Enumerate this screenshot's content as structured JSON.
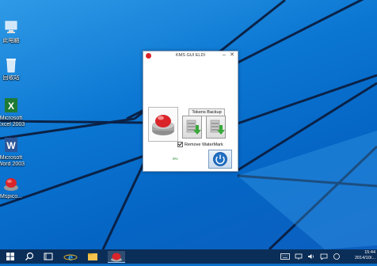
{
  "desktop": {
    "icons": [
      {
        "label": "此电脑",
        "icon": "computer-icon"
      },
      {
        "label": "回收站",
        "icon": "recycle-bin-icon"
      },
      {
        "label": "Microsoft",
        "label2": "Excel 2003",
        "icon": "excel-icon"
      },
      {
        "label": "Microsoft",
        "label2": "Word 2003",
        "icon": "word-icon"
      },
      {
        "label": "Mspico...",
        "icon": "red-button-icon"
      }
    ]
  },
  "window": {
    "title": "KMS GUI ELDI",
    "minimize_glyph": "–",
    "close_glyph": "✕",
    "tokens_backup_label": "Tokens Backup",
    "remove_watermark_label": "Remove WaterMark",
    "status_text": "0%"
  },
  "taskbar": {
    "items": [
      "start-icon",
      "search-icon",
      "task-view-icon",
      "internet-explorer-icon",
      "file-explorer-icon",
      "kms-app-icon"
    ],
    "tray": [
      "keyboard-icon",
      "network-icon",
      "volume-icon",
      "action-center-icon"
    ],
    "clock_time": "15:44",
    "clock_date": "2014/10/..."
  },
  "colors": {
    "desktop_blue": "#0b76d2",
    "taskbar": "#0c284e",
    "accent_red": "#d9242a",
    "power_blue": "#1f6fc4",
    "arrow_green": "#3aa83a"
  }
}
